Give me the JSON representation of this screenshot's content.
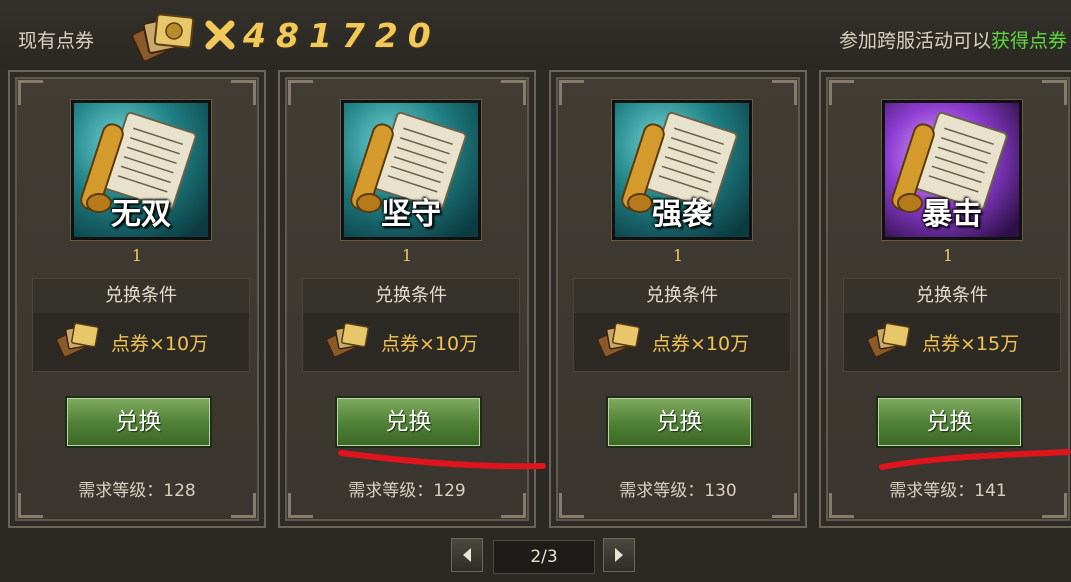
{
  "header": {
    "coupon_label": "现有点券",
    "coupon_count": "481720",
    "hint_prefix": "参加跨服活动可以",
    "hint_highlight": "获得点券"
  },
  "cards": [
    {
      "skill_name": "无双",
      "quantity": "1",
      "condition_title": "兑换条件",
      "cost_label": "点券×10万",
      "button_label": "兑换",
      "level_req": "需求等级：128",
      "icon_style": "teal"
    },
    {
      "skill_name": "坚守",
      "quantity": "1",
      "condition_title": "兑换条件",
      "cost_label": "点券×10万",
      "button_label": "兑换",
      "level_req": "需求等级：129",
      "icon_style": "teal"
    },
    {
      "skill_name": "强袭",
      "quantity": "1",
      "condition_title": "兑换条件",
      "cost_label": "点券×10万",
      "button_label": "兑换",
      "level_req": "需求等级：130",
      "icon_style": "teal"
    },
    {
      "skill_name": "暴击",
      "quantity": "1",
      "condition_title": "兑换条件",
      "cost_label": "点券×15万",
      "button_label": "兑换",
      "level_req": "需求等级：141",
      "icon_style": "purple"
    }
  ],
  "pagination": {
    "page_label": "2/3"
  },
  "colors": {
    "accent_gold": "#f1c85a",
    "hint_green": "#5fd93f",
    "button_green": "#4f7f35",
    "annotation_red": "#e0141c"
  }
}
